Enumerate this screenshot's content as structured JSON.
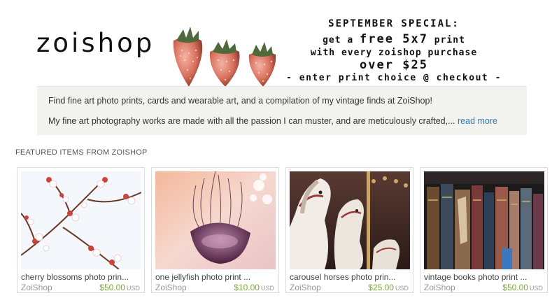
{
  "banner": {
    "logo": "zoishop",
    "promo_line1": "SEPTEMBER SPECIAL:",
    "promo_line2a": "get a ",
    "promo_line2b": "free 5x7",
    "promo_line2c": " print",
    "promo_line3": "with every zoishop purchase",
    "promo_line4": "over $25",
    "promo_line5": "- enter print choice @ checkout -"
  },
  "announcement": {
    "line1": "Find fine art photo prints, cards and wearable art, and a compilation of my vintage finds at ZoiShop!",
    "line2": "My fine art photography works are made with all the passion I can muster, and are meticulously crafted,...",
    "read_more": "read more"
  },
  "featured": {
    "title": "FEATURED ITEMS FROM ZOISHOP",
    "items": [
      {
        "title": "cherry blossoms photo prin...",
        "shop": "ZoiShop",
        "price": "$50.00",
        "currency": "USD"
      },
      {
        "title": "one jellyfish photo print ...",
        "shop": "ZoiShop",
        "price": "$10.00",
        "currency": "USD"
      },
      {
        "title": "carousel horses photo prin...",
        "shop": "ZoiShop",
        "price": "$25.00",
        "currency": "USD"
      },
      {
        "title": "vintage books photo print ...",
        "shop": "ZoiShop",
        "price": "$50.00",
        "currency": "USD"
      }
    ]
  }
}
